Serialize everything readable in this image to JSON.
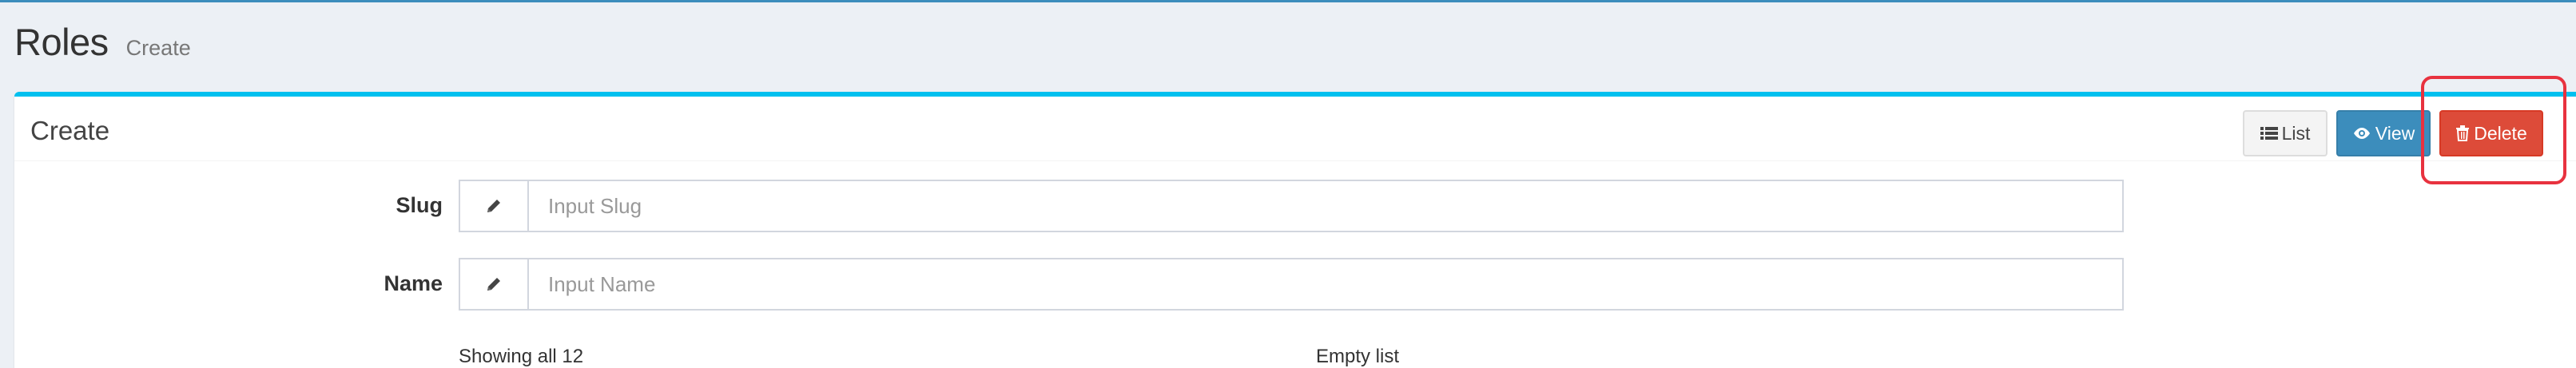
{
  "header": {
    "title": "Roles",
    "subtitle": "Create"
  },
  "box": {
    "title": "Create",
    "buttons": {
      "list_label": "List",
      "view_label": "View",
      "delete_label": "Delete"
    }
  },
  "form": {
    "slug": {
      "label": "Slug",
      "value": "",
      "placeholder": "Input Slug",
      "icon": "pencil-icon"
    },
    "name": {
      "label": "Name",
      "value": "",
      "placeholder": "Input Name",
      "icon": "pencil-icon"
    }
  },
  "permissions": {
    "available_info": "Showing all 12",
    "selected_info": "Empty list"
  },
  "colors": {
    "header_border": "#3c8dbc",
    "box_border": "#00c0ef",
    "view_button": "#3c8dbc",
    "delete_button": "#dd4b39",
    "highlight": "#e8323f"
  }
}
